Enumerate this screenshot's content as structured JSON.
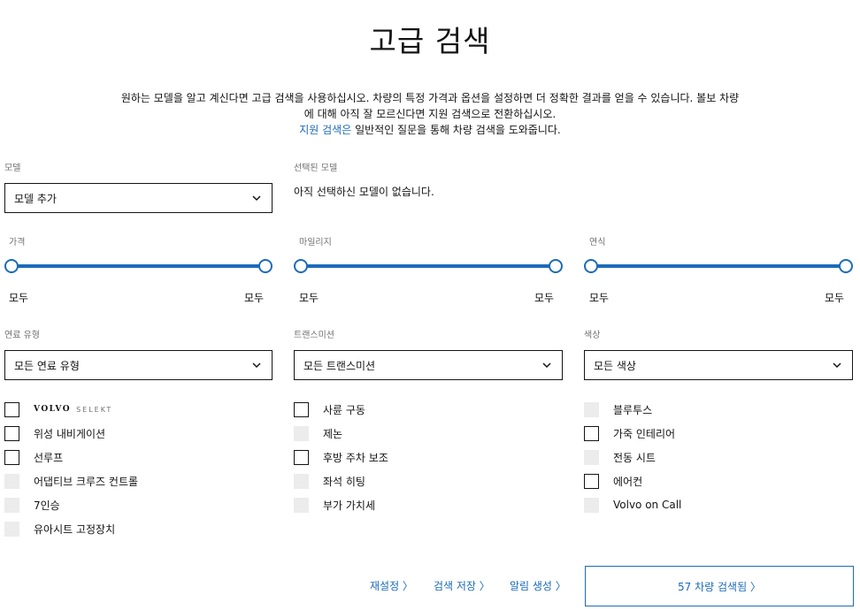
{
  "page": {
    "title": "고급 검색",
    "intro_line1": "원하는 모델을 알고 계신다면 고급 검색을 사용하십시오. 차량의 특정 가격과 옵션을 설정하면 더 정확한 결과를 얻을 수 있습니다. 볼보 차량",
    "intro_line2": "에 대해 아직 잘 모르신다면 지원 검색으로 전환하십시오.",
    "intro_link": "지원 검색은",
    "intro_line3_rest": " 일반적인 질문을 통해 차량 검색을 도와줍니다."
  },
  "model": {
    "label": "모델",
    "select_value": "모델 추가"
  },
  "selected_models": {
    "label": "선택된 모델",
    "empty_text": "아직 선택하신 모델이 없습니다."
  },
  "sliders": [
    {
      "label": "가격",
      "min_text": "모두",
      "max_text": "모두"
    },
    {
      "label": "마일리지",
      "min_text": "모두",
      "max_text": "모두"
    },
    {
      "label": "연식",
      "min_text": "모두",
      "max_text": "모두"
    }
  ],
  "filters": [
    {
      "label": "연료 유형",
      "value": "모든 연료 유형"
    },
    {
      "label": "트랜스미션",
      "value": "모든 트랜스미션"
    },
    {
      "label": "색상",
      "value": "모든 색상"
    }
  ],
  "options_col1": [
    {
      "text": "VOLVO",
      "extra": "SELEKT",
      "enabled": true,
      "checked": false
    },
    {
      "text": "위성 내비게이션",
      "enabled": true,
      "checked": false
    },
    {
      "text": "선루프",
      "enabled": true,
      "checked": false
    },
    {
      "text": "어댑티브 크루즈 컨트롤",
      "enabled": false,
      "checked": false
    },
    {
      "text": "7인승",
      "enabled": false,
      "checked": false
    },
    {
      "text": "유아시트 고정장치",
      "enabled": false,
      "checked": false
    }
  ],
  "options_col2": [
    {
      "text": "사륜 구동",
      "enabled": true,
      "checked": false
    },
    {
      "text": "제논",
      "enabled": false,
      "checked": false
    },
    {
      "text": "후방 주차 보조",
      "enabled": true,
      "checked": false
    },
    {
      "text": "좌석 히팅",
      "enabled": false,
      "checked": false
    },
    {
      "text": "부가 가치세",
      "enabled": false,
      "checked": false
    }
  ],
  "options_col3": [
    {
      "text": "블루투스",
      "enabled": false,
      "checked": false
    },
    {
      "text": "가죽 인테리어",
      "enabled": true,
      "checked": false
    },
    {
      "text": "전동 시트",
      "enabled": false,
      "checked": false
    },
    {
      "text": "에어컨",
      "enabled": true,
      "checked": false
    },
    {
      "text": "Volvo on Call",
      "enabled": false,
      "checked": false
    }
  ],
  "actions": {
    "reset": "재설정 〉",
    "save_search": "검색 저장 〉",
    "create_alert": "알림 생성 〉",
    "results": "57 차량 검색됨 〉"
  },
  "colors": {
    "accent": "#1c6bba",
    "text": "#141414",
    "muted": "#707070",
    "disabled": "#ececec"
  }
}
